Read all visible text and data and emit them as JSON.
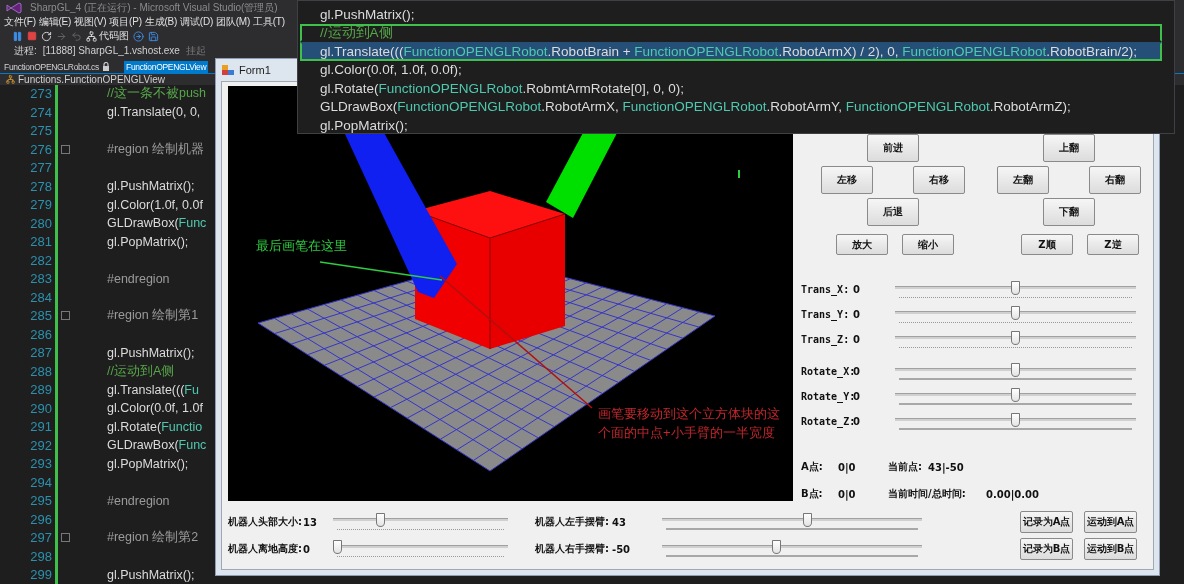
{
  "vs": {
    "title": "SharpGL_4 (正在运行) - Microsoft Visual Studio(管理员)",
    "menu": [
      "文件(F)",
      "编辑(E)",
      "视图(V)",
      "项目(P)",
      "生成(B)",
      "调试(D)",
      "团队(M)",
      "工具(T)"
    ],
    "toolbar": {
      "code_map": "代码图"
    },
    "process": {
      "label": "进程:",
      "value": "[11888] SharpGL_1.vshost.exe",
      "suspend": "挂起"
    },
    "tabs": [
      {
        "label": "FunctionOPENGLRobot.cs",
        "selected": false,
        "locked": true
      },
      {
        "label": "FunctionOPENGLView",
        "selected": true
      }
    ],
    "nav": "Functions.FunctionOPENGLView",
    "editor": {
      "lines": [
        {
          "number": "273",
          "fold": false,
          "segments": [
            {
              "text": "//这一条不被push",
              "kind": "comment"
            }
          ]
        },
        {
          "number": "274",
          "fold": false,
          "segments": [
            {
              "text": "gl.Translate(0, 0,",
              "kind": "plain"
            }
          ]
        },
        {
          "number": "275",
          "fold": false
        },
        {
          "number": "276",
          "fold": true,
          "segments": [
            {
              "text": "#region 绘制机器",
              "kind": "region"
            }
          ]
        },
        {
          "number": "277",
          "fold": false
        },
        {
          "number": "278",
          "fold": false,
          "segments": [
            {
              "text": "gl.PushMatrix();",
              "kind": "plain"
            }
          ]
        },
        {
          "number": "279",
          "fold": false,
          "segments": [
            {
              "text": "gl.Color(1.0f, 0.0f",
              "kind": "plain"
            }
          ]
        },
        {
          "number": "280",
          "fold": false,
          "segments": [
            {
              "text": "GLDrawBox(",
              "kind": "plain"
            },
            {
              "text": "Func",
              "kind": "type"
            }
          ]
        },
        {
          "number": "281",
          "fold": false,
          "segments": [
            {
              "text": "gl.PopMatrix();",
              "kind": "plain"
            }
          ]
        },
        {
          "number": "282",
          "fold": false
        },
        {
          "number": "283",
          "fold": false,
          "segments": [
            {
              "text": "#endregion",
              "kind": "region"
            }
          ]
        },
        {
          "number": "284",
          "fold": false
        },
        {
          "number": "285",
          "fold": true,
          "segments": [
            {
              "text": "#region 绘制第1",
              "kind": "region"
            }
          ]
        },
        {
          "number": "286",
          "fold": false
        },
        {
          "number": "287",
          "fold": false,
          "segments": [
            {
              "text": "gl.PushMatrix();",
              "kind": "plain"
            }
          ]
        },
        {
          "number": "288",
          "fold": false,
          "segments": [
            {
              "text": "//运动到A侧",
              "kind": "comment"
            }
          ]
        },
        {
          "number": "289",
          "fold": false,
          "segments": [
            {
              "text": "gl.Translate(((",
              "kind": "plain"
            },
            {
              "text": "Fu",
              "kind": "type"
            }
          ]
        },
        {
          "number": "290",
          "fold": false,
          "segments": [
            {
              "text": "gl.Color(0.0f, 1.0f",
              "kind": "plain"
            }
          ]
        },
        {
          "number": "291",
          "fold": false,
          "segments": [
            {
              "text": "gl.Rotate(",
              "kind": "plain"
            },
            {
              "text": "Functio",
              "kind": "type"
            }
          ]
        },
        {
          "number": "292",
          "fold": false,
          "segments": [
            {
              "text": "GLDrawBox(",
              "kind": "plain"
            },
            {
              "text": "Func",
              "kind": "type"
            }
          ]
        },
        {
          "number": "293",
          "fold": false,
          "segments": [
            {
              "text": "gl.PopMatrix();",
              "kind": "plain"
            }
          ]
        },
        {
          "number": "294",
          "fold": false
        },
        {
          "number": "295",
          "fold": false,
          "segments": [
            {
              "text": "#endregion",
              "kind": "region"
            }
          ]
        },
        {
          "number": "296",
          "fold": false
        },
        {
          "number": "297",
          "fold": true,
          "segments": [
            {
              "text": "#region 绘制第2",
              "kind": "region"
            }
          ]
        },
        {
          "number": "298",
          "fold": false
        },
        {
          "number": "299",
          "fold": false,
          "segments": [
            {
              "text": "gl.PushMatrix();",
              "kind": "plain"
            }
          ]
        }
      ]
    }
  },
  "popup": {
    "lines": [
      {
        "selected": false,
        "framed": false,
        "segments": [
          {
            "text": "gl.PushMatrix();",
            "kind": "plain"
          }
        ]
      },
      {
        "selected": false,
        "framed": true,
        "segments": [
          {
            "text": "//运动到A侧",
            "kind": "comment"
          }
        ]
      },
      {
        "selected": true,
        "framed": true,
        "segments": [
          {
            "text": "gl.Translate(((",
            "kind": "plain"
          },
          {
            "text": "FunctionOPENGLRobot",
            "kind": "type"
          },
          {
            "text": ".RobotBrain + ",
            "kind": "plain"
          },
          {
            "text": "FunctionOPENGLRobot",
            "kind": "type"
          },
          {
            "text": ".RobotArmX) / 2), 0, ",
            "kind": "plain"
          },
          {
            "text": "FunctionOPENGLRobot",
            "kind": "type"
          },
          {
            "text": ".RobotBrain/2);",
            "kind": "plain"
          }
        ]
      },
      {
        "selected": false,
        "framed": false,
        "segments": [
          {
            "text": "gl.Color(0.0f, 1.0f, 0.0f);",
            "kind": "plain"
          }
        ]
      },
      {
        "selected": false,
        "framed": false,
        "segments": [
          {
            "text": "gl.Rotate(",
            "kind": "plain"
          },
          {
            "text": "FunctionOPENGLRobot",
            "kind": "type"
          },
          {
            "text": ".RobmtArmRotate[0], 0, 0);",
            "kind": "plain"
          }
        ]
      },
      {
        "selected": false,
        "framed": false,
        "segments": [
          {
            "text": "GLDrawBox(",
            "kind": "plain"
          },
          {
            "text": "FunctionOPENGLRobot",
            "kind": "type"
          },
          {
            "text": ".RobotArmX, ",
            "kind": "plain"
          },
          {
            "text": "FunctionOPENGLRobot",
            "kind": "type"
          },
          {
            "text": ".RobotArmY, ",
            "kind": "plain"
          },
          {
            "text": "FunctionOPENGLRobot",
            "kind": "type"
          },
          {
            "text": ".RobotArmZ);",
            "kind": "plain"
          }
        ]
      },
      {
        "selected": false,
        "framed": false,
        "segments": [
          {
            "text": "gl.PopMatrix();",
            "kind": "plain"
          }
        ]
      }
    ]
  },
  "form": {
    "title": "Form1",
    "annotations": [
      {
        "text": "最后画笔在这里",
        "color": "#2ecc40"
      },
      {
        "text": "画笔要移动到这个立方体块的这个面的中点+小手臂的一半宽度",
        "color": "#c0262c"
      }
    ],
    "move_buttons": [
      "前进",
      "左移",
      "右移",
      "后退"
    ],
    "flip_buttons": [
      "上翻",
      "左翻",
      "右翻",
      "下翻"
    ],
    "zoom_buttons": [
      "放大",
      "缩小",
      "Z顺",
      "Z逆"
    ],
    "sliders": [
      {
        "label": "Trans_X:",
        "value": "0",
        "level": 0.5,
        "kind": "sparse"
      },
      {
        "label": "Trans_Y:",
        "value": "0",
        "level": 0.5,
        "kind": "sparse"
      },
      {
        "label": "Trans_Z:",
        "value": "0",
        "level": 0.5,
        "kind": "sparse"
      },
      {
        "label": "Rotate_X:",
        "value": "0",
        "level": 0.5,
        "kind": "dense"
      },
      {
        "label": "Rotate_Y:",
        "value": "0",
        "level": 0.5,
        "kind": "dense"
      },
      {
        "label": "Rotate_Z:",
        "value": "0",
        "level": 0.5,
        "kind": "dense"
      }
    ],
    "readouts": [
      [
        {
          "label": "A点:",
          "value": "0|0"
        },
        {
          "label": "当前点:",
          "value": "43|-50"
        }
      ],
      [
        {
          "label": "B点:",
          "value": "0|0"
        },
        {
          "label": "当前时间/总时间:",
          "value": "0.00|0.00"
        }
      ]
    ],
    "bottom_sliders": [
      {
        "label": "机器人头部大小:",
        "value": "13",
        "level": 0.26,
        "kind": "sparse"
      },
      {
        "label": "机器人离地高度:",
        "value": "0",
        "level": 0,
        "kind": "sparse"
      },
      {
        "label": "机器人左手摆臂:",
        "value": "43",
        "level": 0.56,
        "kind": "dense"
      },
      {
        "label": "机器人右手摆臂:",
        "value": "-50",
        "level": 0.44,
        "kind": "dense"
      }
    ],
    "bottom_buttons": [
      "记录为A点",
      "运动到A点",
      "记录为B点",
      "运动到B点"
    ]
  }
}
